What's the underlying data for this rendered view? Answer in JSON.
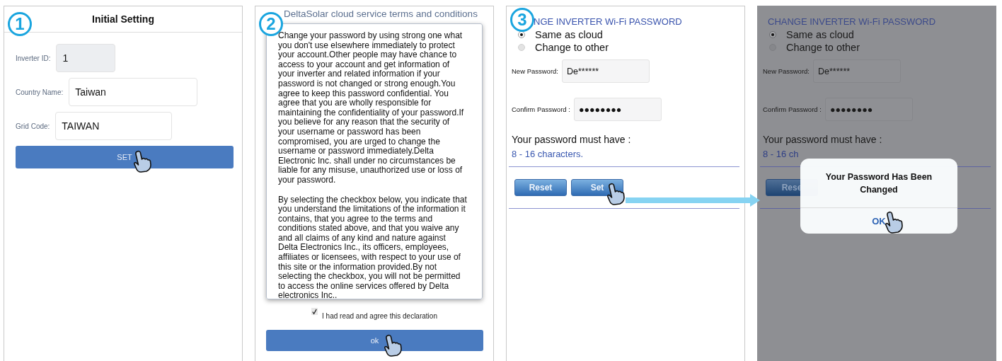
{
  "panels": [
    {
      "kind": "initial_setting",
      "badge": "1",
      "title": "Initial Setting",
      "fields": [
        {
          "label": "Inverter ID:",
          "value": "1",
          "disabled": true
        },
        {
          "label": "Country Name:",
          "value": "Taiwan",
          "disabled": false
        },
        {
          "label": "Grid Code:",
          "value": "TAIWAN",
          "disabled": false
        }
      ],
      "button": "SET"
    },
    {
      "kind": "terms",
      "badge": "2",
      "title": "DeltaSolar cloud service terms and conditions",
      "paragraphs": [
        "Change your password by using strong one what you don't use elsewhere immediately to protect your account.Other people may have chance to access to your account and get information of your inverter and related information if your password is not changed or strong enough.You agree to keep this password confidential. You agree that you are wholly responsible for maintaining the confidentiality of your password.If you believe for any reason that the security of your username or password has been compromised, you are urged to change the username or password immediately.Delta Electronic Inc. shall under no circumstances be liable for any misuse, unauthorized use or loss of your password.",
        "By selecting the checkbox below, you indicate that you understand the limitations of the information it contains, that you agree to the terms and conditions stated above, and that you waive any and all claims of any kind and nature against Delta Electronics Inc., its officers, employees, affiliates or licensees, with respect to your use of this site or the information provided.By not selecting the checkbox, you will not be permitted to access the online services offered by Delta electronics Inc.."
      ],
      "checkbox": {
        "label": "I had read and agree this declaration",
        "checked": true
      },
      "button": "ok"
    },
    {
      "kind": "wifi_password",
      "badge": "3",
      "title": "NGE INVERTER Wi-Fi PASSWORD",
      "dimmed": false,
      "options": [
        {
          "label": "Same as cloud",
          "selected": true
        },
        {
          "label": "Change to other",
          "selected": false
        }
      ],
      "fields": [
        {
          "label": "New Password:",
          "value": "De******"
        },
        {
          "label": "Confirm Password :",
          "value": "●●●●●●●●"
        }
      ],
      "requirement": "Your password must have :",
      "rule": "8 - 16 characters.",
      "buttons": [
        "Reset",
        "Set"
      ]
    },
    {
      "kind": "wifi_password",
      "title": "CHANGE INVERTER Wi-Fi PASSWORD",
      "dimmed": true,
      "options": [
        {
          "label": "Same as cloud",
          "selected": true
        },
        {
          "label": "Change to other",
          "selected": false
        }
      ],
      "fields": [
        {
          "label": "New Password:",
          "value": "De******"
        },
        {
          "label": "Confirm Password :",
          "value": "●●●●●●●●"
        }
      ],
      "requirement": "Your password must have :",
      "rule": "8 - 16 ch",
      "buttons": [
        "Rese"
      ],
      "dialog": {
        "message": "Your Password Has Been Changed",
        "button": "OK"
      }
    }
  ]
}
